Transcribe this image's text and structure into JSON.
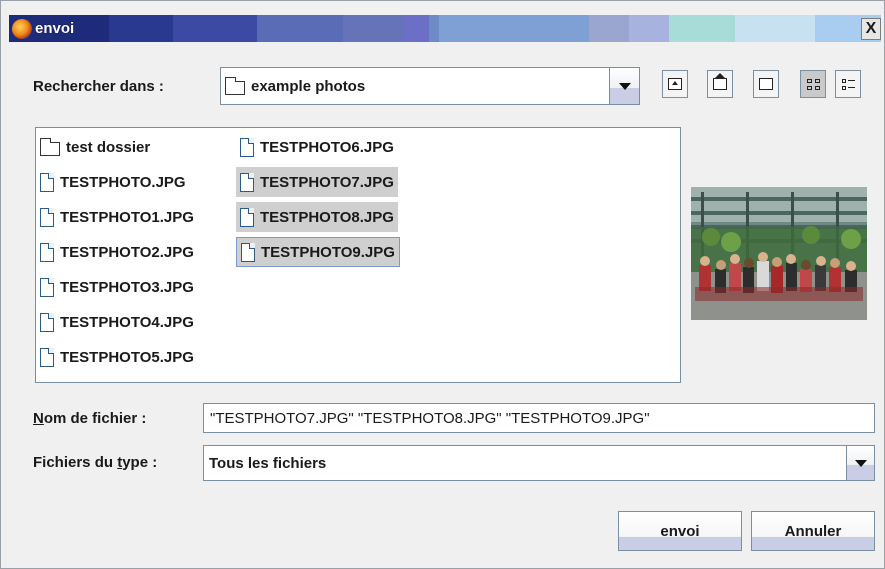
{
  "window": {
    "title": "envoi",
    "close_label": "X",
    "titlebar_colors": [
      "#1e2a7a",
      "#2a3990",
      "#3c4aa3",
      "#5a6cb6",
      "#6673b8",
      "#6b6fc5",
      "#6e8bc7",
      "#7fa0d4",
      "#9aa6d0",
      "#a8b2de",
      "#a8dcd9",
      "#c8e1f0",
      "#a9cdf0"
    ]
  },
  "look_in": {
    "label": "Rechercher dans :",
    "value": "example photos"
  },
  "toolbar": {
    "buttons": [
      "up-folder-icon",
      "home-icon",
      "new-folder-icon",
      "list-view-icon",
      "details-view-icon"
    ]
  },
  "files": {
    "column1": [
      {
        "name": "test dossier",
        "type": "folder"
      },
      {
        "name": "TESTPHOTO.JPG",
        "type": "file"
      },
      {
        "name": "TESTPHOTO1.JPG",
        "type": "file"
      },
      {
        "name": "TESTPHOTO2.JPG",
        "type": "file"
      },
      {
        "name": "TESTPHOTO3.JPG",
        "type": "file"
      },
      {
        "name": "TESTPHOTO4.JPG",
        "type": "file"
      },
      {
        "name": "TESTPHOTO5.JPG",
        "type": "file"
      }
    ],
    "column2": [
      {
        "name": "TESTPHOTO6.JPG",
        "type": "file",
        "selected": false
      },
      {
        "name": "TESTPHOTO7.JPG",
        "type": "file",
        "selected": true
      },
      {
        "name": "TESTPHOTO8.JPG",
        "type": "file",
        "selected": true
      },
      {
        "name": "TESTPHOTO9.JPG",
        "type": "file",
        "selected": true
      }
    ]
  },
  "filename": {
    "label_prefix": "N",
    "label_rest": "om de fichier :",
    "value": "\"TESTPHOTO7.JPG\" \"TESTPHOTO8.JPG\" \"TESTPHOTO9.JPG\""
  },
  "filetype": {
    "label_a": "Fichiers du ",
    "label_underline": "t",
    "label_b": "ype :",
    "value": "Tous les fichiers"
  },
  "buttons": {
    "ok": "envoi",
    "cancel": "Annuler"
  }
}
